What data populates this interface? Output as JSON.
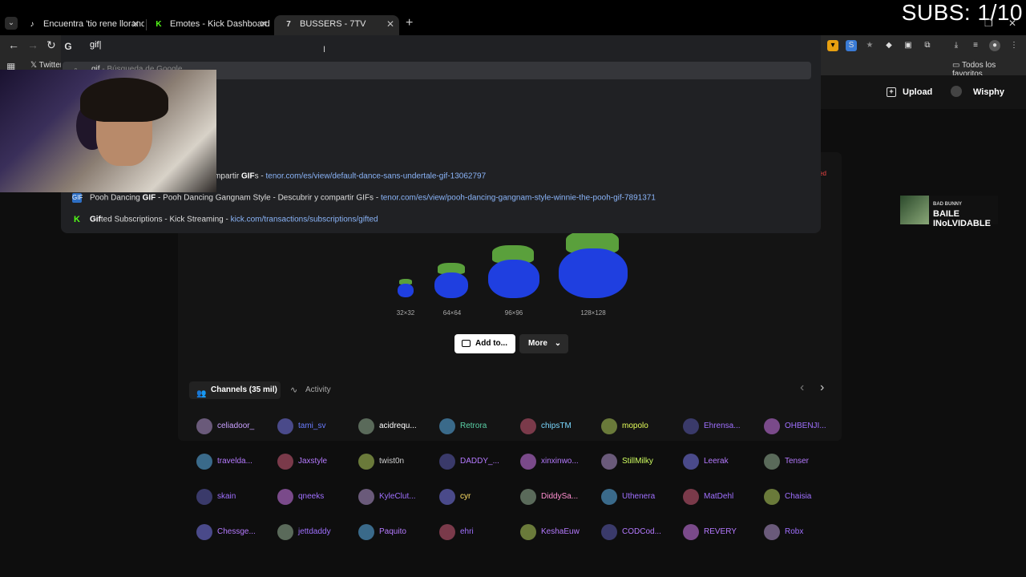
{
  "browser": {
    "tabs": [
      {
        "label": "Encuentra 'tio rene llorando' en",
        "icon": "tiktok-icon"
      },
      {
        "label": "Emotes - Kick Dashboard",
        "icon": "kick-icon"
      },
      {
        "label": "BUSSERS - 7TV",
        "icon": "7tv-icon"
      }
    ],
    "overlay_text": "SUBS: 1/10",
    "omnibox": {
      "typed": "gif",
      "first_suggestion_query": "gif",
      "first_suggestion_hint": "- Búsqueda de Google",
      "suggestions": [
        {
          "pre": "ce Sans Undertale - Descubrir y compartir ",
          "bold": "GIF",
          "post": "s",
          "sep": " - ",
          "url": "tenor.com/es/view/default-dance-sans-undertale-gif-13062797"
        },
        {
          "pre": "Pooh Dancing ",
          "bold": "GIF",
          "post": " - Pooh Dancing Gangnam Style - Descubrir y compartir GIFs",
          "sep": " - ",
          "url": "tenor.com/es/view/pooh-dancing-gangnam-style-winnie-the-pooh-gif-7891371"
        },
        {
          "pre": "",
          "bold": "Gif",
          "post": "ted Subscriptions - Kick Streaming",
          "sep": " - ",
          "url": "kick.com/transactions/subscriptions/gifted"
        }
      ]
    },
    "bookmarks": {
      "item1": "Twitter",
      "all": "Todos los favoritos"
    }
  },
  "page": {
    "nav": {
      "upload": "Upload",
      "user": "Wisphy"
    },
    "emote_sizes": [
      "32×32",
      "64×64",
      "96×96",
      "128×128"
    ],
    "actions": {
      "add": "Add to...",
      "more": "More"
    },
    "banner": {
      "artist": "BAD BUNNY",
      "song": "BAILE INoLVIDABLE"
    },
    "channel_tabs": {
      "channels": "Channels (35 mil)",
      "activity": "Activity"
    },
    "channels": [
      [
        "celiadoor_",
        "tami_sv",
        "acidrequ...",
        "Retrora",
        "chipsTM",
        "mopolo",
        "Ehrensa...",
        "OHBENJI..."
      ],
      [
        "travelda...",
        "Jaxstyle",
        "twist0n",
        "DADDY_...",
        "xinxinwo...",
        "StillMilky",
        "Leerak",
        "Tenser"
      ],
      [
        "skain",
        "qneeks",
        "KyleClut...",
        "cyr",
        "DiddySa...",
        "Uthenera",
        "MatDehl",
        "Chaisia"
      ],
      [
        "Chessge...",
        "jettdaddy",
        "Paquito",
        "ehri",
        "KeshaEuw",
        "CODCod...",
        "REVERY",
        "Robx"
      ]
    ],
    "channel_colors": [
      [
        "#c9a0ff",
        "#6a7cff",
        "#ffffff",
        "#5ad1a6",
        "#7ad8ff",
        "#e6ff5a",
        "#a070ff",
        "#a070ff"
      ],
      [
        "#b57aff",
        "#b57aff",
        "#d0d0d0",
        "#b57aff",
        "#b57aff",
        "#d0ff60",
        "#b57aff",
        "#b57aff"
      ],
      [
        "#a070ff",
        "#a070ff",
        "#a070ff",
        "#ffe066",
        "#ff8fd0",
        "#a070ff",
        "#a070ff",
        "#a070ff"
      ],
      [
        "#b57aff",
        "#a070ff",
        "#b57aff",
        "#a070ff",
        "#b57aff",
        "#b57aff",
        "#b57aff",
        "#a070ff"
      ]
    ]
  }
}
